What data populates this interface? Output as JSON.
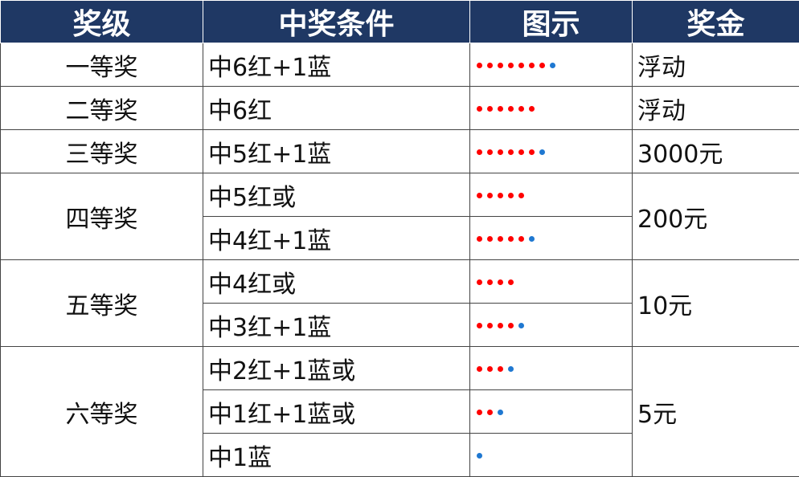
{
  "headers": [
    "奖级",
    "中奖条件",
    "图示",
    "奖金"
  ],
  "colors": {
    "header_bg": "#1f3864",
    "red_ball": "#ff0000",
    "blue_ball": "#1f78d1"
  },
  "rows": [
    {
      "level": "一等奖",
      "condition": "中6红+1蓝",
      "red": 7,
      "blue": 1,
      "prize": "浮动"
    },
    {
      "level": "二等奖",
      "condition": "中6红",
      "red": 6,
      "blue": 0,
      "prize": "浮动"
    },
    {
      "level": "三等奖",
      "condition": "中5红+1蓝",
      "red": 6,
      "blue": 1,
      "prize": "3000元"
    },
    {
      "level": "四等奖",
      "condition": "中5红或",
      "red": 5,
      "blue": 0,
      "prize": "200元"
    },
    {
      "condition": "中4红+1蓝",
      "red": 5,
      "blue": 1
    },
    {
      "level": "五等奖",
      "condition": "中4红或",
      "red": 4,
      "blue": 0,
      "prize": "10元"
    },
    {
      "condition": "中3红+1蓝",
      "red": 4,
      "blue": 1
    },
    {
      "level": "六等奖",
      "condition": "中2红+1蓝或",
      "red": 3,
      "blue": 1,
      "prize": "5元"
    },
    {
      "condition": "中1红+1蓝或",
      "red": 2,
      "blue": 1
    },
    {
      "condition": "中1蓝",
      "red": 0,
      "blue": 1
    }
  ]
}
